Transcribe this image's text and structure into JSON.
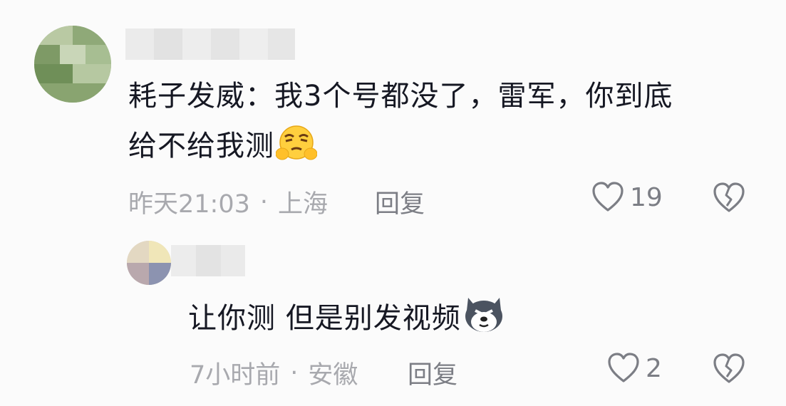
{
  "comments": [
    {
      "text_line1": "耗子发威：我3个号都没了，雷军，你到底",
      "text_line2": "给不给我测",
      "emoji": "sulking-face-emoji",
      "time": "昨天21:03",
      "location": "上海",
      "reply_label": "回复",
      "like_count": "19"
    },
    {
      "text": "让你测 但是别发视频",
      "emoji": "husky-dog-emoji",
      "time": "7小时前",
      "location": "安徽",
      "reply_label": "回复",
      "like_count": "2"
    }
  ],
  "separator": "·",
  "icons": {
    "like": "heart-outline-icon",
    "dislike": "broken-heart-icon"
  },
  "colors": {
    "text": "#161823",
    "meta": "#a8a9ae",
    "action": "#7c7e85",
    "background": "#fbfbfb"
  }
}
